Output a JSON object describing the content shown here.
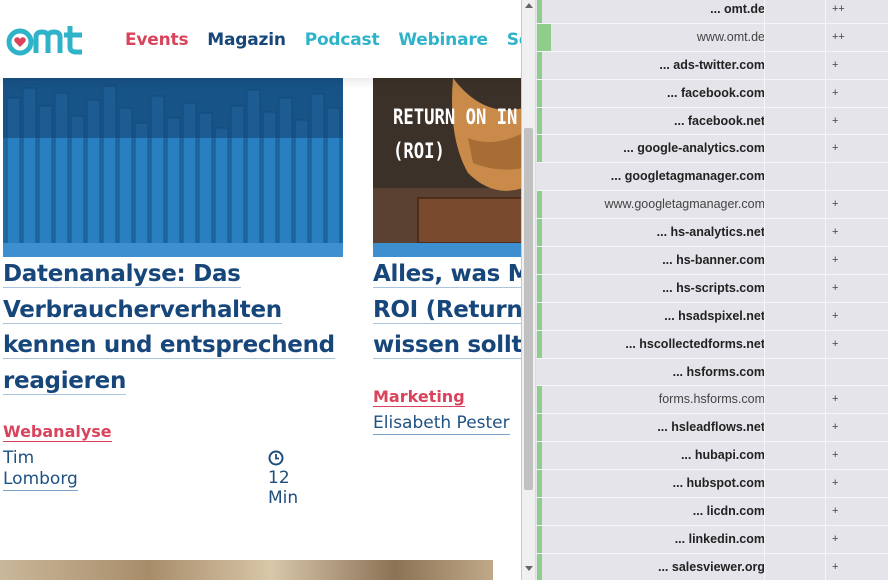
{
  "site": {
    "nav": [
      {
        "label": "Events",
        "color": "#d9445c"
      },
      {
        "label": "Magazin",
        "color": "#17467b"
      },
      {
        "label": "Podcast",
        "color": "#2fb3c9"
      },
      {
        "label": "Webinare",
        "color": "#2fb3c9"
      },
      {
        "label": "Seminare",
        "color": "#2fb3c9"
      }
    ],
    "cards": [
      {
        "title_lines": [
          "Datenanalyse: Das",
          "Verbraucherverhalten",
          "kennen und entsprechend",
          "reagieren"
        ],
        "category": "Webanalyse",
        "author": "Tim Lomborg",
        "read_time": "12 Min"
      },
      {
        "image_text": [
          "RETURN ON IN",
          "(ROI)"
        ],
        "title_lines": [
          "Alles, was Ma",
          "ROI (Return (",
          "wissen sollte"
        ],
        "category": "Marketing",
        "author": "Elisabeth Pester"
      }
    ],
    "colors": {
      "navy": "#17467b",
      "pink": "#d9445c",
      "teal": "#2fb3c9"
    }
  },
  "panel": {
    "colors": {
      "bar": "#8fcd8a",
      "row": "#e4e4ea"
    },
    "rows": [
      {
        "domain": "... omt.de",
        "flag": "++",
        "bar": true,
        "bold": true
      },
      {
        "domain": "www.omt.de",
        "flag": "++",
        "bar": "wide",
        "bold": false
      },
      {
        "domain": "... ads-twitter.com",
        "flag": "+",
        "bar": true,
        "bold": true
      },
      {
        "domain": "... facebook.com",
        "flag": "+",
        "bar": true,
        "bold": true
      },
      {
        "domain": "... facebook.net",
        "flag": "+",
        "bar": true,
        "bold": true
      },
      {
        "domain": "... google-analytics.com",
        "flag": "+",
        "bar": true,
        "bold": true
      },
      {
        "domain": "... googletagmanager.com",
        "flag": "",
        "bar": false,
        "bold": true
      },
      {
        "domain": "www.googletagmanager.com",
        "flag": "+",
        "bar": true,
        "bold": false
      },
      {
        "domain": "... hs-analytics.net",
        "flag": "+",
        "bar": true,
        "bold": true
      },
      {
        "domain": "... hs-banner.com",
        "flag": "+",
        "bar": true,
        "bold": true
      },
      {
        "domain": "... hs-scripts.com",
        "flag": "+",
        "bar": true,
        "bold": true
      },
      {
        "domain": "... hsadspixel.net",
        "flag": "+",
        "bar": true,
        "bold": true
      },
      {
        "domain": "... hscollectedforms.net",
        "flag": "+",
        "bar": true,
        "bold": true
      },
      {
        "domain": "... hsforms.com",
        "flag": "",
        "bar": false,
        "bold": true
      },
      {
        "domain": "forms.hsforms.com",
        "flag": "+",
        "bar": true,
        "bold": false
      },
      {
        "domain": "... hsleadflows.net",
        "flag": "+",
        "bar": true,
        "bold": true
      },
      {
        "domain": "... hubapi.com",
        "flag": "+",
        "bar": true,
        "bold": true
      },
      {
        "domain": "... hubspot.com",
        "flag": "+",
        "bar": true,
        "bold": true
      },
      {
        "domain": "... licdn.com",
        "flag": "+",
        "bar": true,
        "bold": true
      },
      {
        "domain": "... linkedin.com",
        "flag": "+",
        "bar": true,
        "bold": true
      },
      {
        "domain": "... salesviewer.org",
        "flag": "+",
        "bar": true,
        "bold": true
      }
    ]
  }
}
